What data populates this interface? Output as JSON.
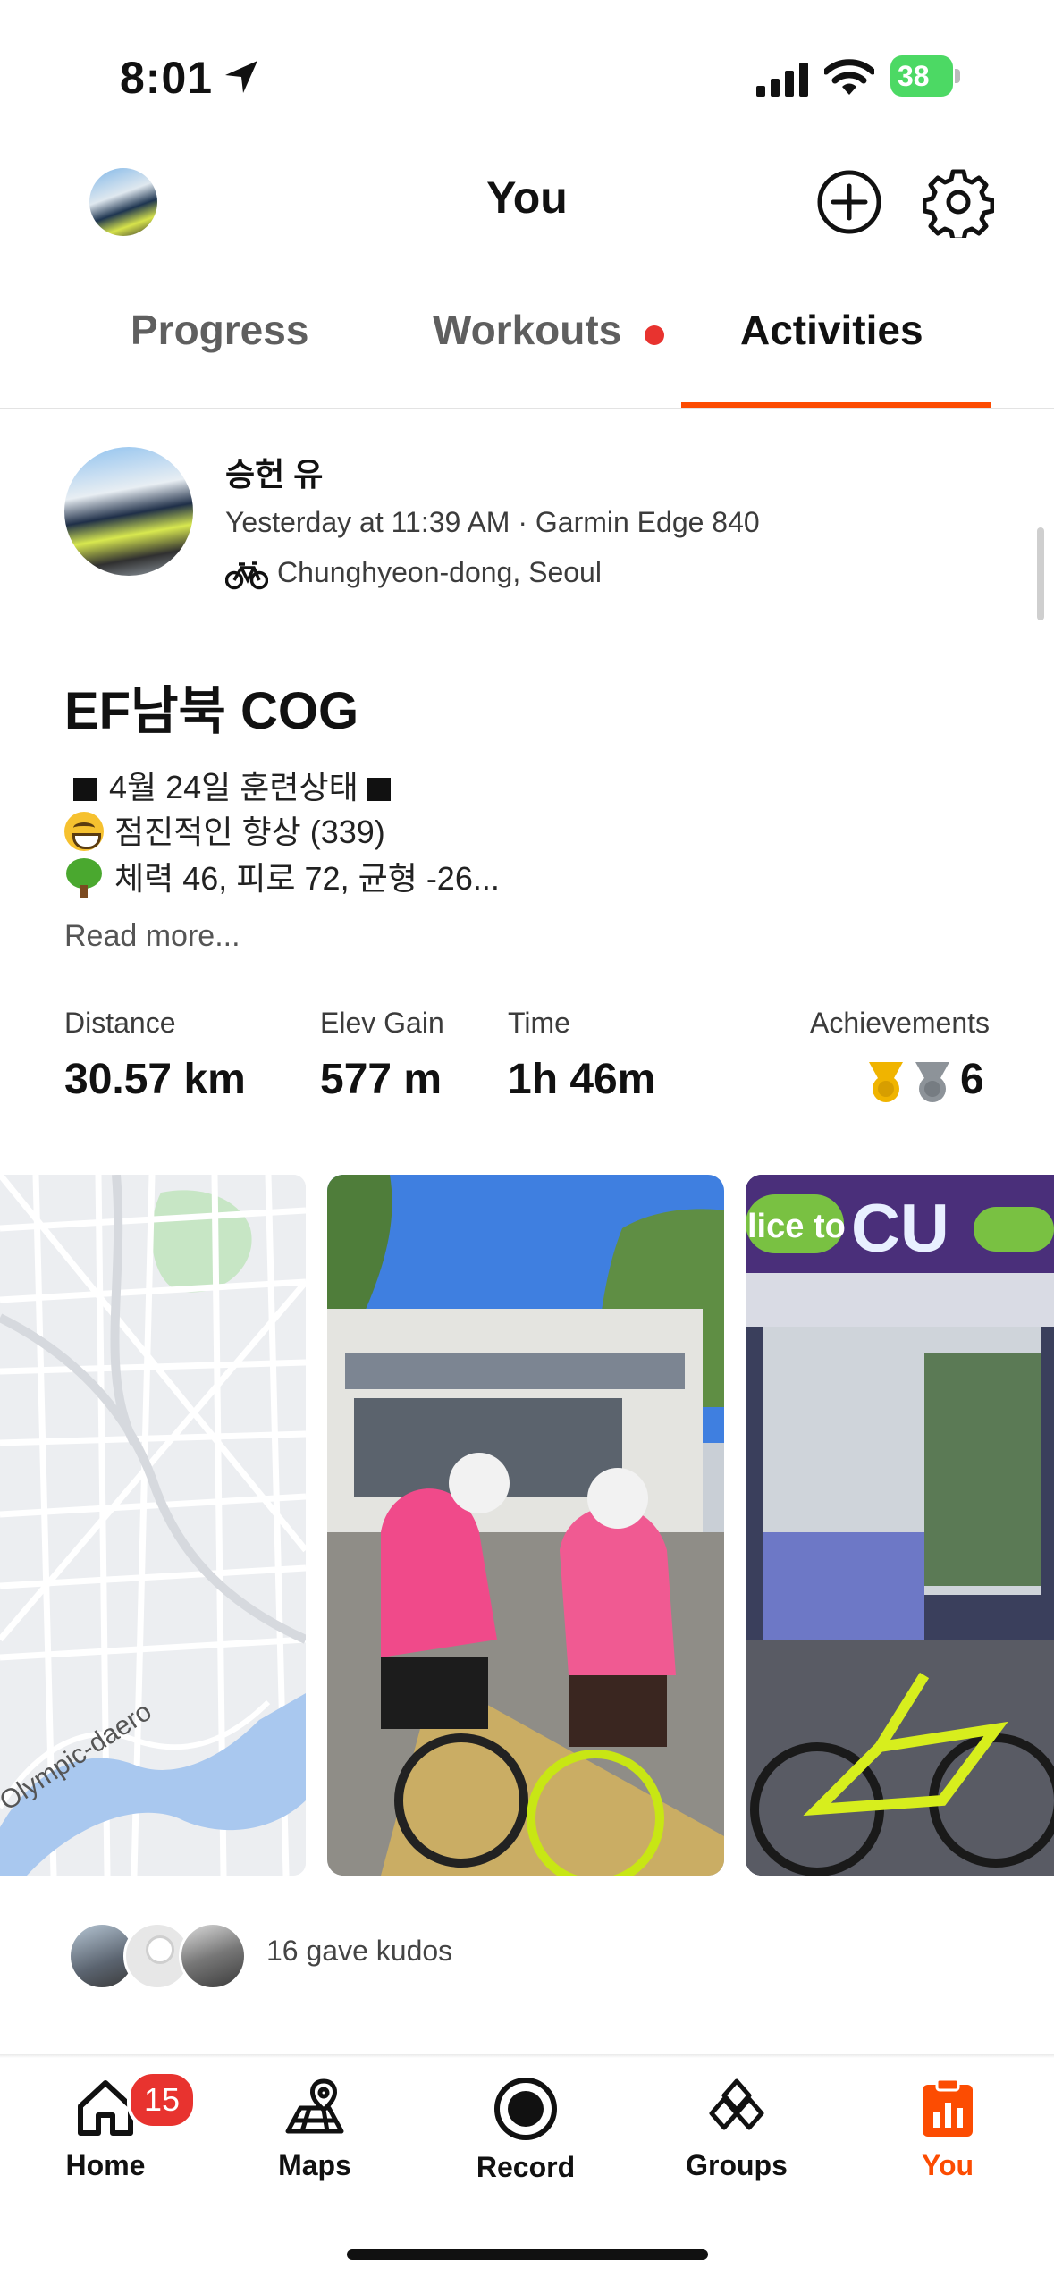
{
  "status_bar": {
    "time": "8:01",
    "battery": "38"
  },
  "header": {
    "title": "You"
  },
  "tabs": [
    {
      "label": "Progress"
    },
    {
      "label": "Workouts"
    },
    {
      "label": "Activities"
    }
  ],
  "activity": {
    "athlete_name": "승헌 유",
    "meta": "Yesterday at 11:39 AM · Garmin Edge 840",
    "location": "Chunghyeon-dong, Seoul",
    "title": "EF남북 COG",
    "description": [
      "4월 24일 훈련상태",
      "점진적인 향상 (339)",
      "체력 46, 피로 72, 균형 -26..."
    ],
    "read_more": "Read more...",
    "stats": [
      {
        "label": "Distance",
        "value": "30.57 km"
      },
      {
        "label": "Elev Gain",
        "value": "577 m"
      },
      {
        "label": "Time",
        "value": "1h 46m"
      }
    ],
    "achievements": {
      "label": "Achievements",
      "count": "6"
    },
    "map_label": "Olympic-daero",
    "kudos_text": "16 gave kudos"
  },
  "photo_sign": {
    "text_left": "lice to",
    "text_brand": "CU"
  },
  "nav": {
    "home": "Home",
    "maps": "Maps",
    "record": "Record",
    "groups": "Groups",
    "you": "You",
    "home_badge": "15"
  },
  "colors": {
    "accent": "#fc4c02",
    "badge": "#e8332f"
  }
}
